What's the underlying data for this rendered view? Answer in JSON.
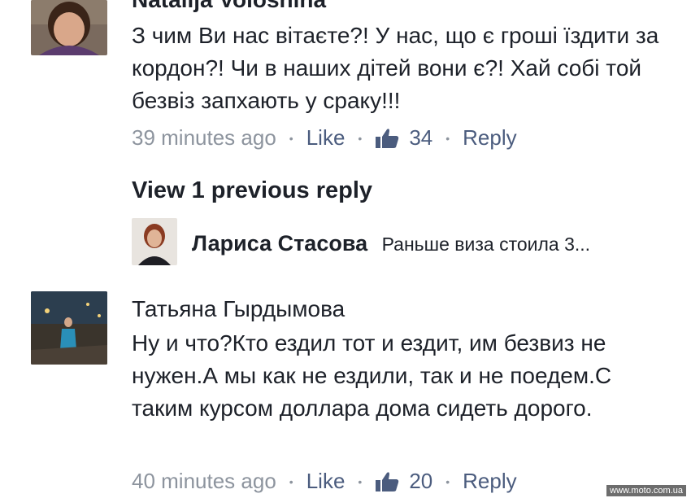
{
  "comments": [
    {
      "name": "Natalija Voloshina",
      "text": "З чим Ви нас вітаєте?! У нас, що є гроші їздити за кордон?! Чи в наших дітей вони є?! Хай собі той безвіз запхають у сраку!!!",
      "time": "39 minutes ago",
      "like_label": "Like",
      "like_count": "34",
      "reply_label": "Reply"
    },
    {
      "name": "Татьяна Гырдымова",
      "text": "Ну и что?Кто ездил тот и ездит, им безвиз не нужен.А мы как не ездили, так и не поедем.С таким курсом доллара дома сидеть дорого.",
      "time": "40 minutes ago",
      "like_label": "Like",
      "like_count": "20",
      "reply_label": "Reply"
    }
  ],
  "view_previous": "View 1 previous reply",
  "reply_preview": {
    "name": "Лариса Стасова",
    "text": "Раньше виза стоила 3..."
  },
  "icons": {
    "like": "thumbs-up-icon"
  },
  "colors": {
    "link": "#4b5c7e",
    "meta": "#8d949e"
  },
  "watermark": "www.moto.com.ua"
}
